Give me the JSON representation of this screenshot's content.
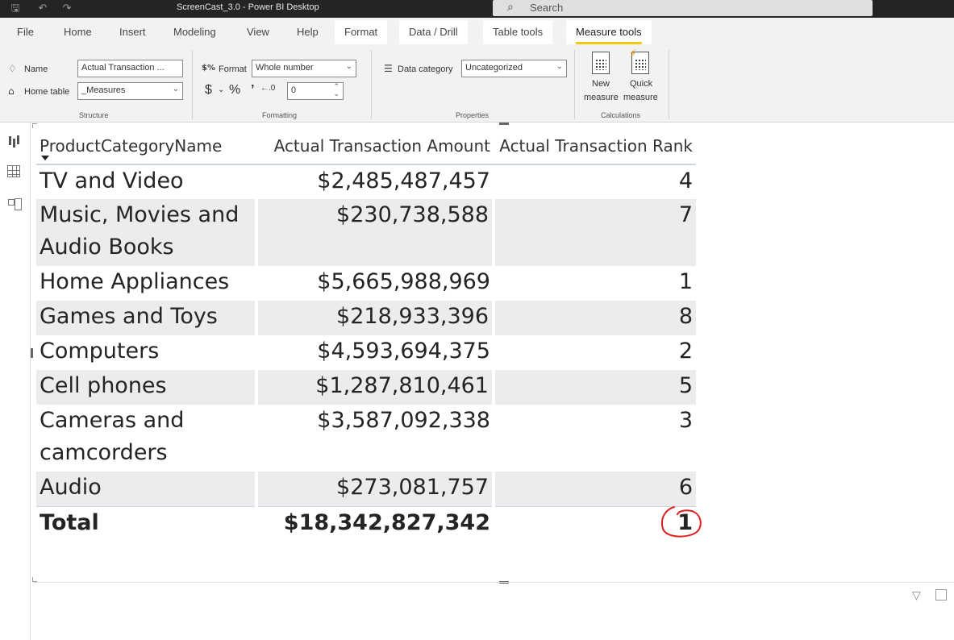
{
  "window": {
    "title": "ScreenCast_3.0 - Power BI Desktop"
  },
  "search": {
    "placeholder": "Search"
  },
  "menu": {
    "file": "File",
    "home": "Home",
    "insert": "Insert",
    "modeling": "Modeling",
    "view": "View",
    "help": "Help",
    "format": "Format",
    "data_drill": "Data / Drill",
    "table_tools": "Table tools",
    "measure_tools": "Measure tools"
  },
  "ribbon": {
    "name_label": "Name",
    "name_value": "Actual Transaction ...",
    "home_table_label": "Home table",
    "home_table_value": "_Measures",
    "structure_label": "Structure",
    "format_label": "Format",
    "format_value": "Whole number",
    "currency_symbol": "$",
    "percent_symbol": "%",
    "comma_symbol": ")",
    "decimal_places": "0",
    "formatting_label": "Formatting",
    "data_category_label": "Data category",
    "data_category_value": "Uncategorized",
    "properties_label": "Properties",
    "new_measure": "New\nmeasure",
    "new_measure_l1": "New",
    "new_measure_l2": "measure",
    "quick_measure_l1": "Quick",
    "quick_measure_l2": "measure",
    "calculations_label": "Calculations",
    "accent_color": "#f2c811"
  },
  "table": {
    "headers": [
      "ProductCategoryName",
      "Actual Transaction Amount",
      "Actual Transaction Rank"
    ],
    "rows": [
      {
        "category": "TV and Video",
        "amount": "$2,485,487,457",
        "rank": "4"
      },
      {
        "category": "Music, Movies and Audio Books",
        "amount": "$230,738,588",
        "rank": "7"
      },
      {
        "category": "Home Appliances",
        "amount": "$5,665,988,969",
        "rank": "1"
      },
      {
        "category": "Games and Toys",
        "amount": "$218,933,396",
        "rank": "8"
      },
      {
        "category": "Computers",
        "amount": "$4,593,694,375",
        "rank": "2"
      },
      {
        "category": "Cell phones",
        "amount": "$1,287,810,461",
        "rank": "5"
      },
      {
        "category": "Cameras and camcorders",
        "amount": "$3,587,092,338",
        "rank": "3"
      },
      {
        "category": "Audio",
        "amount": "$273,081,757",
        "rank": "6"
      }
    ],
    "total": {
      "label": "Total",
      "amount": "$18,342,827,342",
      "rank": "1"
    }
  },
  "annotation": {
    "color": "#e02020"
  }
}
